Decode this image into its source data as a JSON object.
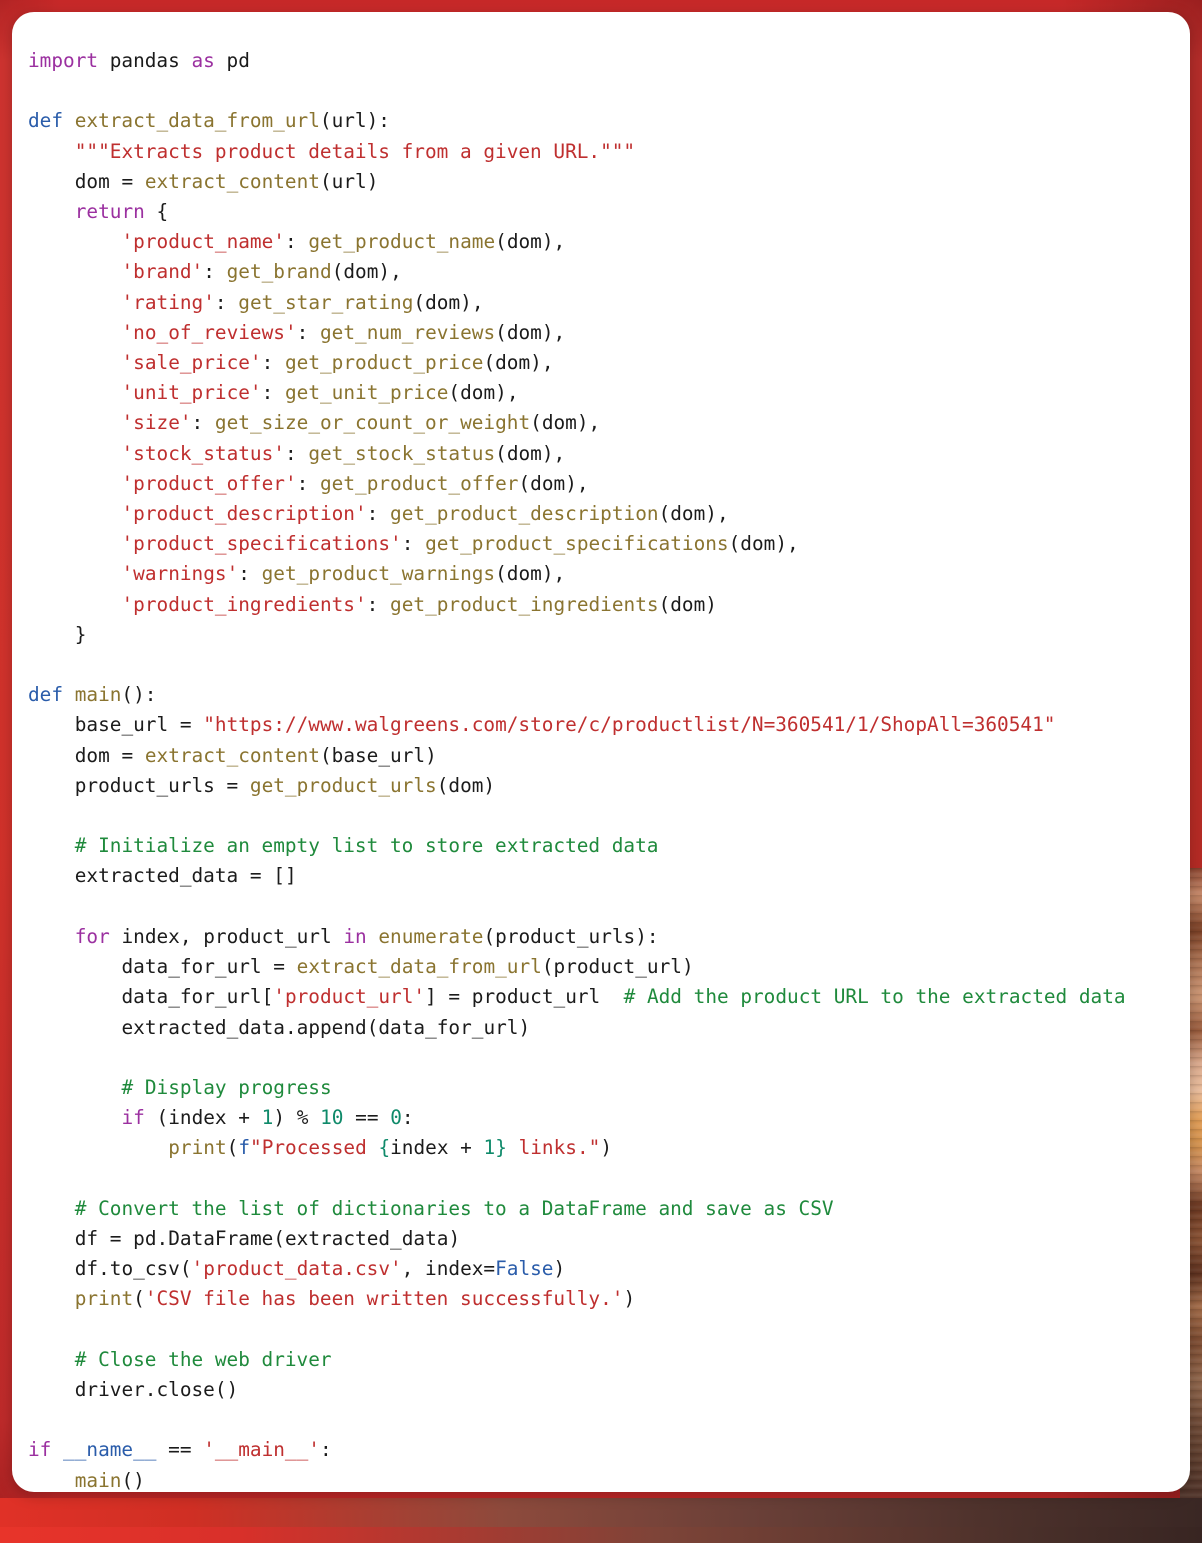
{
  "theme": {
    "backdrop_color": "#e53935",
    "card_color": "#ffffff",
    "keyword_color": "#9b30a0",
    "def_color": "#2a5caa",
    "function_color": "#8a7430",
    "string_color": "#bf2f2f",
    "comment_color": "#1f8a3c",
    "number_color": "#0f8a6a",
    "plain_color": "#1b1b1b"
  },
  "code": {
    "language": "python",
    "lines": [
      "import pandas as pd",
      "",
      "def extract_data_from_url(url):",
      "    \"\"\"Extracts product details from a given URL.\"\"\"",
      "    dom = extract_content(url)",
      "    return {",
      "        'product_name': get_product_name(dom),",
      "        'brand': get_brand(dom),",
      "        'rating': get_star_rating(dom),",
      "        'no_of_reviews': get_num_reviews(dom),",
      "        'sale_price': get_product_price(dom),",
      "        'unit_price': get_unit_price(dom),",
      "        'size': get_size_or_count_or_weight(dom),",
      "        'stock_status': get_stock_status(dom),",
      "        'product_offer': get_product_offer(dom),",
      "        'product_description': get_product_description(dom),",
      "        'product_specifications': get_product_specifications(dom),",
      "        'warnings': get_product_warnings(dom),",
      "        'product_ingredients': get_product_ingredients(dom)",
      "    }",
      "",
      "def main():",
      "    base_url = \"https://www.walgreens.com/store/c/productlist/N=360541/1/ShopAll=360541\"",
      "    dom = extract_content(base_url)",
      "    product_urls = get_product_urls(dom)",
      "",
      "    # Initialize an empty list to store extracted data",
      "    extracted_data = []",
      "",
      "    for index, product_url in enumerate(product_urls):",
      "        data_for_url = extract_data_from_url(product_url)",
      "        data_for_url['product_url'] = product_url  # Add the product URL to the extracted data",
      "        extracted_data.append(data_for_url)",
      "",
      "        # Display progress",
      "        if (index + 1) % 10 == 0:",
      "            print(f\"Processed {index + 1} links.\")",
      "",
      "    # Convert the list of dictionaries to a DataFrame and save as CSV",
      "    df = pd.DataFrame(extracted_data)",
      "    df.to_csv('product_data.csv', index=False)",
      "    print('CSV file has been written successfully.')",
      "",
      "    # Close the web driver",
      "    driver.close()",
      "",
      "if __name__ == '__main__':",
      "    main()"
    ],
    "strings": [
      "\"\"\"Extracts product details from a given URL.\"\"\"",
      "'product_name'",
      "'brand'",
      "'rating'",
      "'no_of_reviews'",
      "'sale_price'",
      "'unit_price'",
      "'size'",
      "'stock_status'",
      "'product_offer'",
      "'product_description'",
      "'product_specifications'",
      "'warnings'",
      "'product_ingredients'",
      "\"https://www.walgreens.com/store/c/productlist/N=360541/1/ShopAll=360541\"",
      "'product_url'",
      "\"Processed {index + 1} links.\"",
      "'product_data.csv'",
      "'CSV file has been written successfully.'",
      "'__main__'"
    ],
    "comments": [
      "# Initialize an empty list to store extracted data",
      "# Add the product URL to the extracted data",
      "# Display progress",
      "# Convert the list of dictionaries to a DataFrame and save as CSV",
      "# Close the web driver"
    ],
    "keywords": [
      "import",
      "as",
      "def",
      "return",
      "for",
      "in",
      "if",
      "False"
    ],
    "functions": [
      "extract_data_from_url",
      "extract_content",
      "get_product_name",
      "get_brand",
      "get_star_rating",
      "get_num_reviews",
      "get_product_price",
      "get_unit_price",
      "get_size_or_count_or_weight",
      "get_stock_status",
      "get_product_offer",
      "get_product_description",
      "get_product_specifications",
      "get_product_warnings",
      "get_product_ingredients",
      "main",
      "get_product_urls",
      "enumerate",
      "print"
    ],
    "numbers": [
      "1",
      "10",
      "0"
    ],
    "url": "https://www.walgreens.com/store/c/productlist/N=360541/1/ShopAll=360541",
    "output_file": "product_data.csv",
    "library": "pandas"
  }
}
